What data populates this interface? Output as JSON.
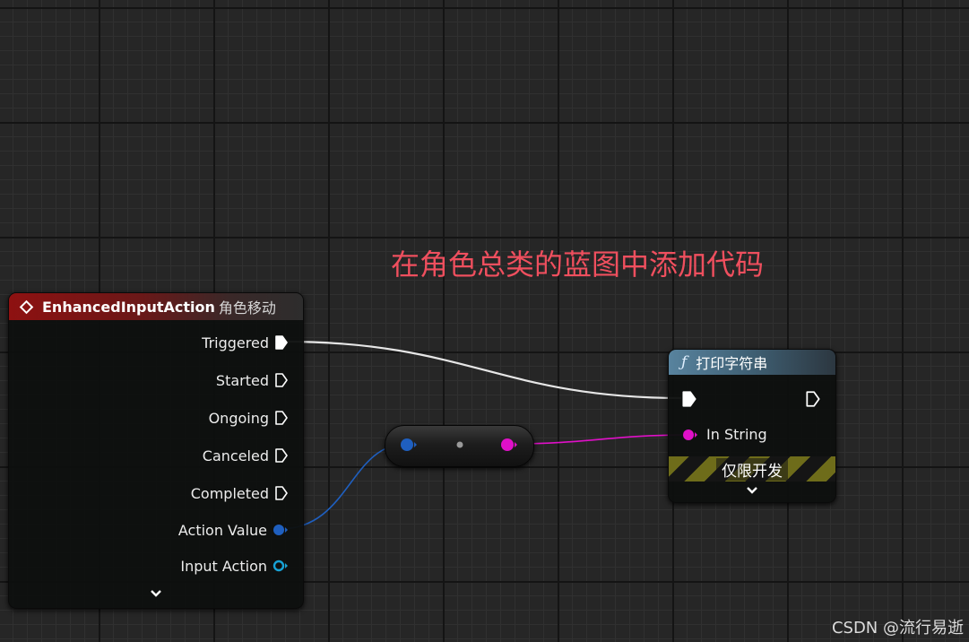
{
  "annotation": "在角色总类的蓝图中添加代码",
  "event_node": {
    "title_bold": "EnhancedInputAction",
    "title_light": "角色移动",
    "outputs": {
      "triggered": "Triggered",
      "started": "Started",
      "ongoing": "Ongoing",
      "canceled": "Canceled",
      "completed": "Completed",
      "action_value": "Action Value",
      "input_action": "Input Action"
    },
    "colors": {
      "header": "#8e1111"
    }
  },
  "print_node": {
    "icon": "function-icon",
    "title": "打印字符串",
    "in_string_label": "In String",
    "dev_only_label": "仅限开发",
    "colors": {
      "header": "#58839e"
    }
  },
  "wire_colors": {
    "exec": "#e8e8e8",
    "vector": "#1f5fbf",
    "string": "#e010c8"
  },
  "watermark": "CSDN @流行易逝"
}
